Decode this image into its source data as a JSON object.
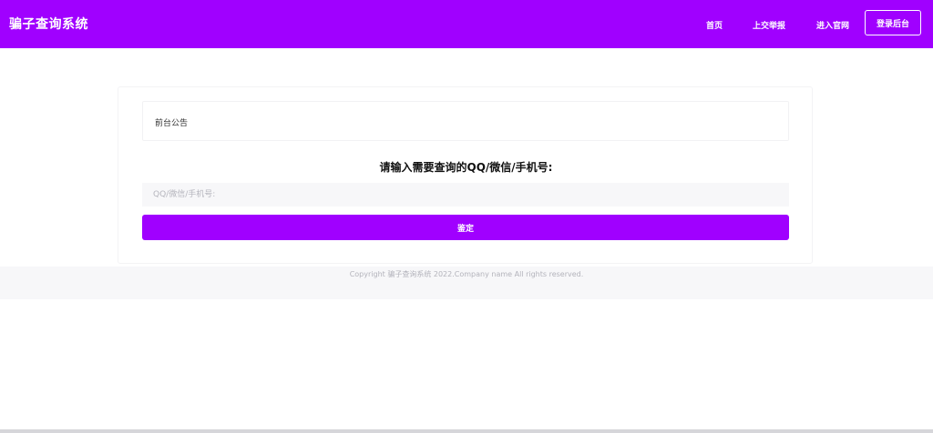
{
  "header": {
    "brand": "骗子查询系统",
    "nav": [
      "首页",
      "上交举报",
      "进入官网"
    ],
    "login_label": "登录后台"
  },
  "main": {
    "notice": "前台公告",
    "query_title": "请输入需要查询的QQ/微信/手机号:",
    "input_placeholder": "QQ/微信/手机号:",
    "input_value": "",
    "submit_label": "鉴定"
  },
  "footer": {
    "copyright": "Copyright 骗子查询系统 2022.Company name All rights reserved."
  },
  "colors": {
    "brand": "#a000ff",
    "footer_bg": "#f7f7f9"
  }
}
